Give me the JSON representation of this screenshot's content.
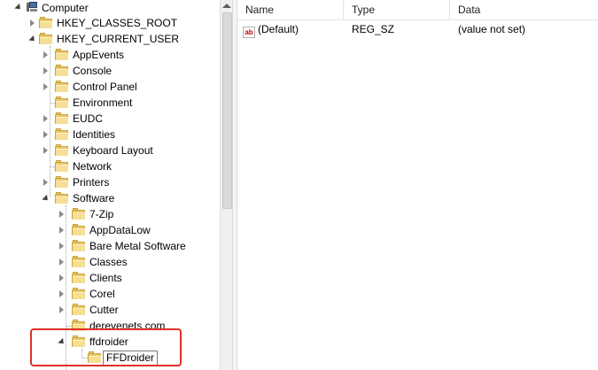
{
  "tree": {
    "computer": "Computer",
    "hkcr": "HKEY_CLASSES_ROOT",
    "hkcu": "HKEY_CURRENT_USER",
    "hkcu_children": [
      "AppEvents",
      "Console",
      "Control Panel",
      "Environment",
      "EUDC",
      "Identities",
      "Keyboard Layout",
      "Network",
      "Printers",
      "Software"
    ],
    "software_children": [
      "7-Zip",
      "AppDataLow",
      "Bare Metal Software",
      "Classes",
      "Clients",
      "Corel",
      "Cutter",
      "derevenets.com",
      "ffdroider"
    ],
    "ffdroider_child": "FFDroider"
  },
  "list": {
    "columns": {
      "name": "Name",
      "type": "Type",
      "data": "Data"
    },
    "rows": [
      {
        "icon": "string-value-icon",
        "icon_text": "ab",
        "name": "(Default)",
        "type": "REG_SZ",
        "data": "(value not set)"
      }
    ]
  },
  "colors": {
    "highlight": "#e0302a"
  }
}
